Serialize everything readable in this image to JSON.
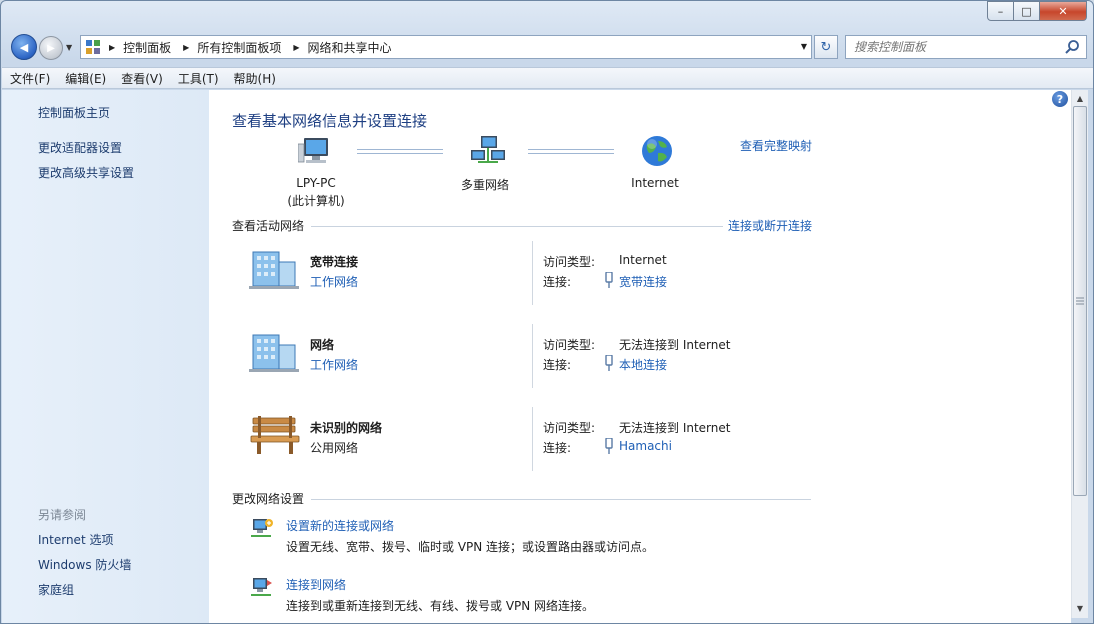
{
  "window": {
    "caption": {
      "min": "–",
      "max": "□",
      "close": "✕"
    }
  },
  "nav": {
    "back_glyph": "◀",
    "forward_glyph": "▶",
    "breadcrumbs": [
      "控制面板",
      "所有控制面板项",
      "网络和共享中心"
    ],
    "search_placeholder": "搜索控制面板",
    "refresh_glyph": "↻"
  },
  "menu": [
    "文件(F)",
    "编辑(E)",
    "查看(V)",
    "工具(T)",
    "帮助(H)"
  ],
  "sidebar": {
    "links": [
      "控制面板主页",
      "更改适配器设置",
      "更改高级共享设置"
    ],
    "see_also_title": "另请参阅",
    "see_also": [
      "Internet 选项",
      "Windows 防火墙",
      "家庭组"
    ]
  },
  "main": {
    "title": "查看基本网络信息并设置连接",
    "full_map": "查看完整映射",
    "map": {
      "pc_name": "LPY-PC",
      "pc_sub": "(此计算机)",
      "middle": "多重网络",
      "internet": "Internet"
    },
    "active_header": "查看活动网络",
    "connect_link": "连接或断开连接",
    "access_label": "访问类型:",
    "conn_label": "连接:",
    "networks": [
      {
        "name": "宽带连接",
        "type": "工作网络",
        "access": "Internet",
        "connection": "宽带连接"
      },
      {
        "name": "网络",
        "type": "工作网络",
        "access": "无法连接到 Internet",
        "connection": "本地连接"
      },
      {
        "name": "未识别的网络",
        "type": "公用网络",
        "access": "无法连接到 Internet",
        "connection": "Hamachi"
      }
    ],
    "settings_header": "更改网络设置",
    "tasks": [
      {
        "link": "设置新的连接或网络",
        "desc": "设置无线、宽带、拨号、临时或 VPN 连接；或设置路由器或访问点。"
      },
      {
        "link": "连接到网络",
        "desc": "连接到或重新连接到无线、有线、拨号或 VPN 网络连接。"
      }
    ],
    "help_glyph": "?"
  },
  "colors": {
    "link": "#1f5fb5",
    "title": "#1e3f82",
    "sidebar_bg": "#e2edf8"
  }
}
